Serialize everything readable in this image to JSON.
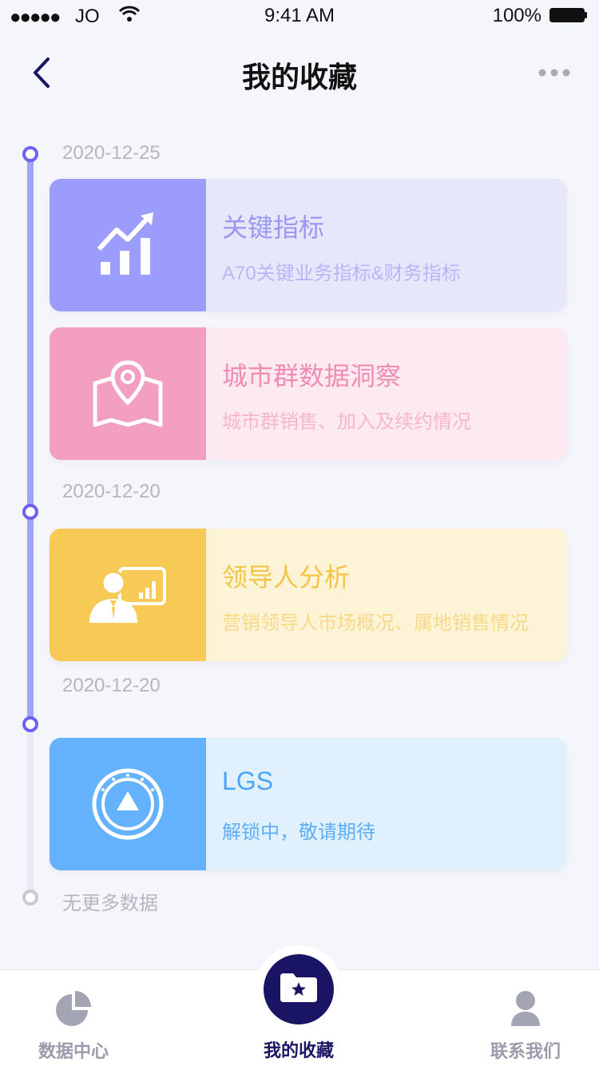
{
  "status_bar": {
    "signal": "●●●●●",
    "carrier": "JO",
    "time": "9:41 AM",
    "battery": "100%"
  },
  "nav": {
    "title": "我的收藏"
  },
  "timeline": {
    "groups": [
      {
        "date": "2020-12-25"
      },
      {
        "date": "2020-12-20"
      },
      {
        "date": "2020-12-20"
      }
    ],
    "end_text": "无更多数据"
  },
  "cards": [
    {
      "title": "关键指标",
      "subtitle": "A70关键业务指标&财务指标",
      "icon": "chart-growth-icon",
      "icon_bg": "#9c9cfd",
      "bg": "#e7e7fb",
      "title_color": "#9a98f3",
      "sub_color": "#b8b6f6"
    },
    {
      "title": "城市群数据洞察",
      "subtitle": "城市群销售、加入及续约情况",
      "icon": "map-pin-icon",
      "icon_bg": "#f39fbf",
      "bg": "#fde9f0",
      "title_color": "#f08db3",
      "sub_color": "#f7b6ce"
    },
    {
      "title": "领导人分析",
      "subtitle": "营销领导人市场概况、属地销售情况",
      "icon": "leader-presentation-icon",
      "icon_bg": "#f7c955",
      "bg": "#fdf3d6",
      "title_color": "#f3c445",
      "sub_color": "#f7d987"
    },
    {
      "title": "LGS",
      "subtitle": "解锁中，敬请期待",
      "icon": "compass-icon",
      "icon_bg": "#64b1fd",
      "bg": "#e1f0fd",
      "title_color": "#4aa5f7",
      "sub_color": "#5eaef7"
    }
  ],
  "tabbar": {
    "tabs": [
      {
        "label": "数据中心",
        "icon": "pie-chart-icon"
      },
      {
        "label": "我的收藏",
        "icon": "star-folder-icon"
      },
      {
        "label": "联系我们",
        "icon": "user-icon"
      }
    ]
  }
}
